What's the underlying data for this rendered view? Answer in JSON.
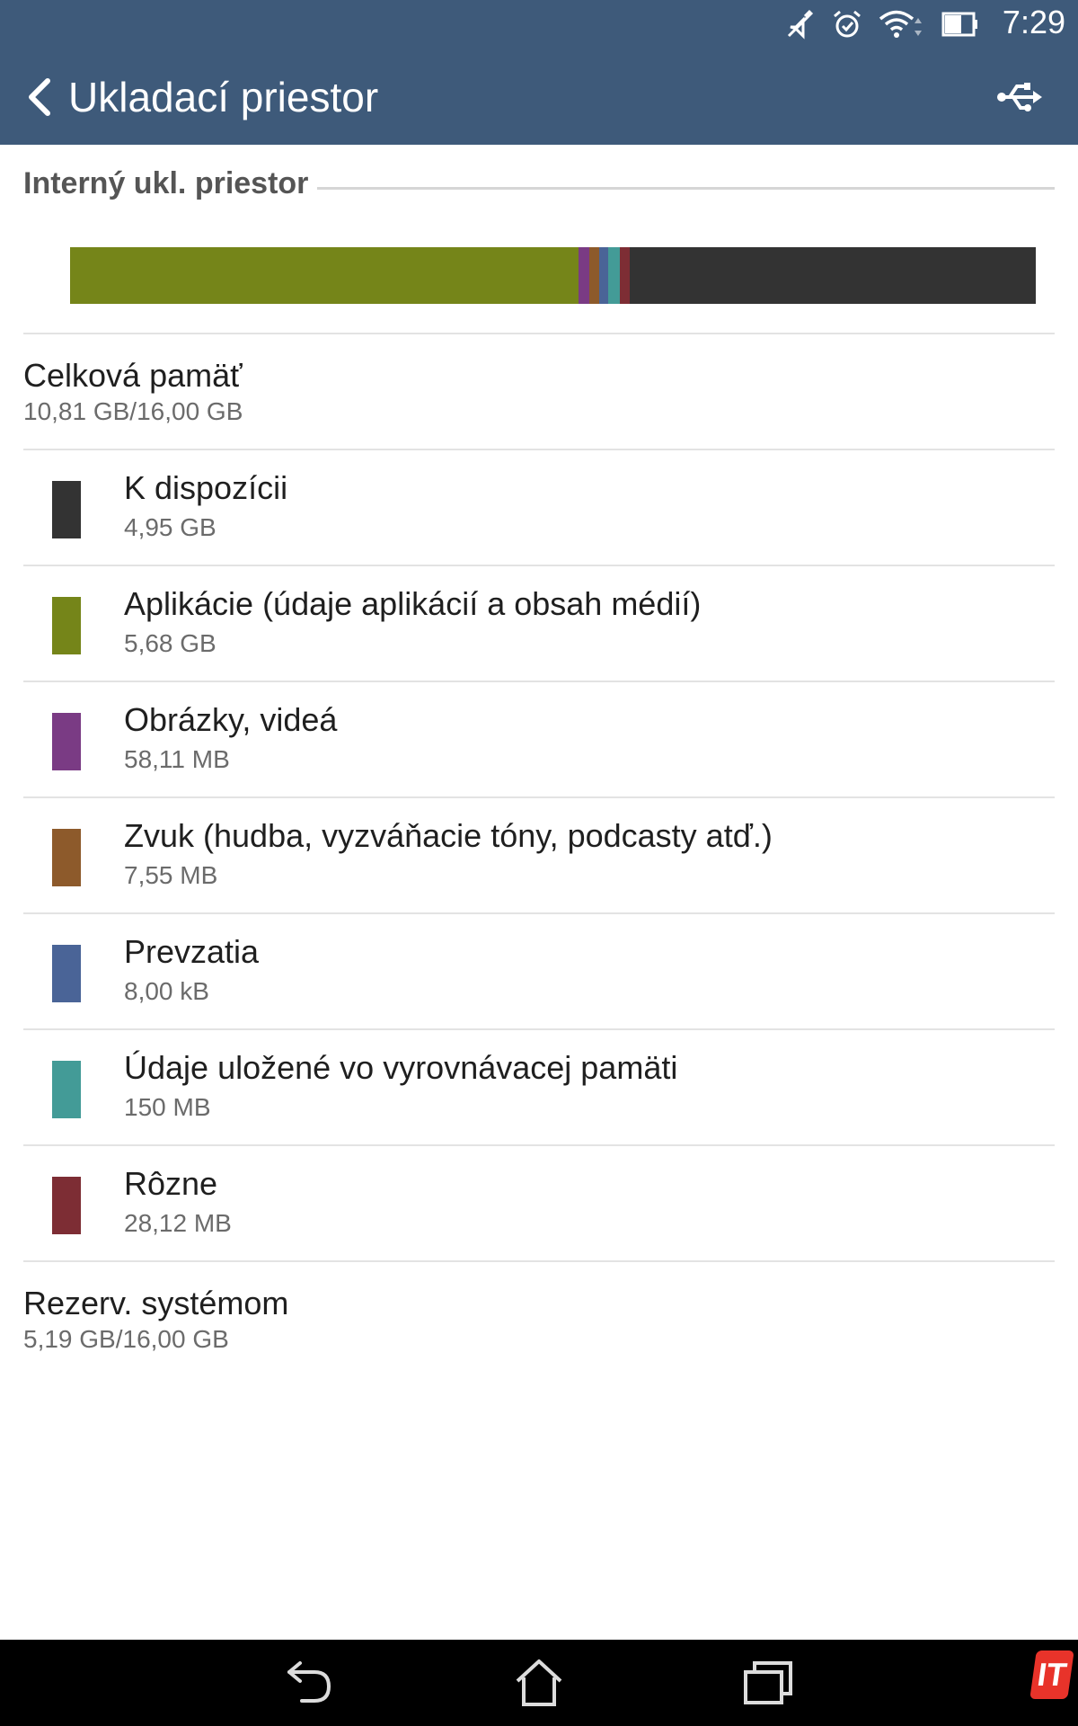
{
  "status_bar": {
    "time": "7:29",
    "icons": [
      "mute-icon",
      "alarm-icon",
      "wifi-icon",
      "battery-icon"
    ]
  },
  "app_bar": {
    "title": "Ukladací priestor",
    "back_icon": "chevron-left-icon",
    "action_icon": "usb-icon",
    "color": "#3e5a7a"
  },
  "section": {
    "title": "Interný ukl. priestor"
  },
  "usage_bar": {
    "segments": [
      {
        "name": "apps",
        "fraction": 0.5265,
        "color": "#758519"
      },
      {
        "name": "pictures",
        "fraction": 0.0112,
        "color": "#7a3b84"
      },
      {
        "name": "audio",
        "fraction": 0.0102,
        "color": "#8d5a2b"
      },
      {
        "name": "downloads",
        "fraction": 0.0093,
        "color": "#4a6497"
      },
      {
        "name": "cache",
        "fraction": 0.0121,
        "color": "#439b97"
      },
      {
        "name": "misc",
        "fraction": 0.0102,
        "color": "#7d2d34"
      },
      {
        "name": "available",
        "fraction": 0.4205,
        "color": "#333333"
      }
    ]
  },
  "total": {
    "title": "Celková pamäť",
    "value": "10,81 GB/16,00 GB"
  },
  "items": [
    {
      "label": "K dispozícii",
      "value": "4,95 GB",
      "color": "#333333"
    },
    {
      "label": "Aplikácie (údaje aplikácií a obsah médií)",
      "value": "5,68 GB",
      "color": "#758519"
    },
    {
      "label": "Obrázky, videá",
      "value": "58,11 MB",
      "color": "#7a3b84"
    },
    {
      "label": "Zvuk (hudba, vyzváňacie tóny, podcasty atď.)",
      "value": "7,55 MB",
      "color": "#8d5a2b"
    },
    {
      "label": "Prevzatia",
      "value": "8,00 kB",
      "color": "#4a6497"
    },
    {
      "label": "Údaje uložené vo vyrovnávacej pamäti",
      "value": "150 MB",
      "color": "#439b97"
    },
    {
      "label": "Rôzne",
      "value": "28,12 MB",
      "color": "#7d2d34"
    }
  ],
  "reserved": {
    "title": "Rezerv. systémom",
    "value": "5,19 GB/16,00 GB"
  },
  "nav_bar": {
    "buttons": [
      "back-icon",
      "home-icon",
      "recents-icon"
    ]
  },
  "watermark": {
    "text": "IT"
  }
}
